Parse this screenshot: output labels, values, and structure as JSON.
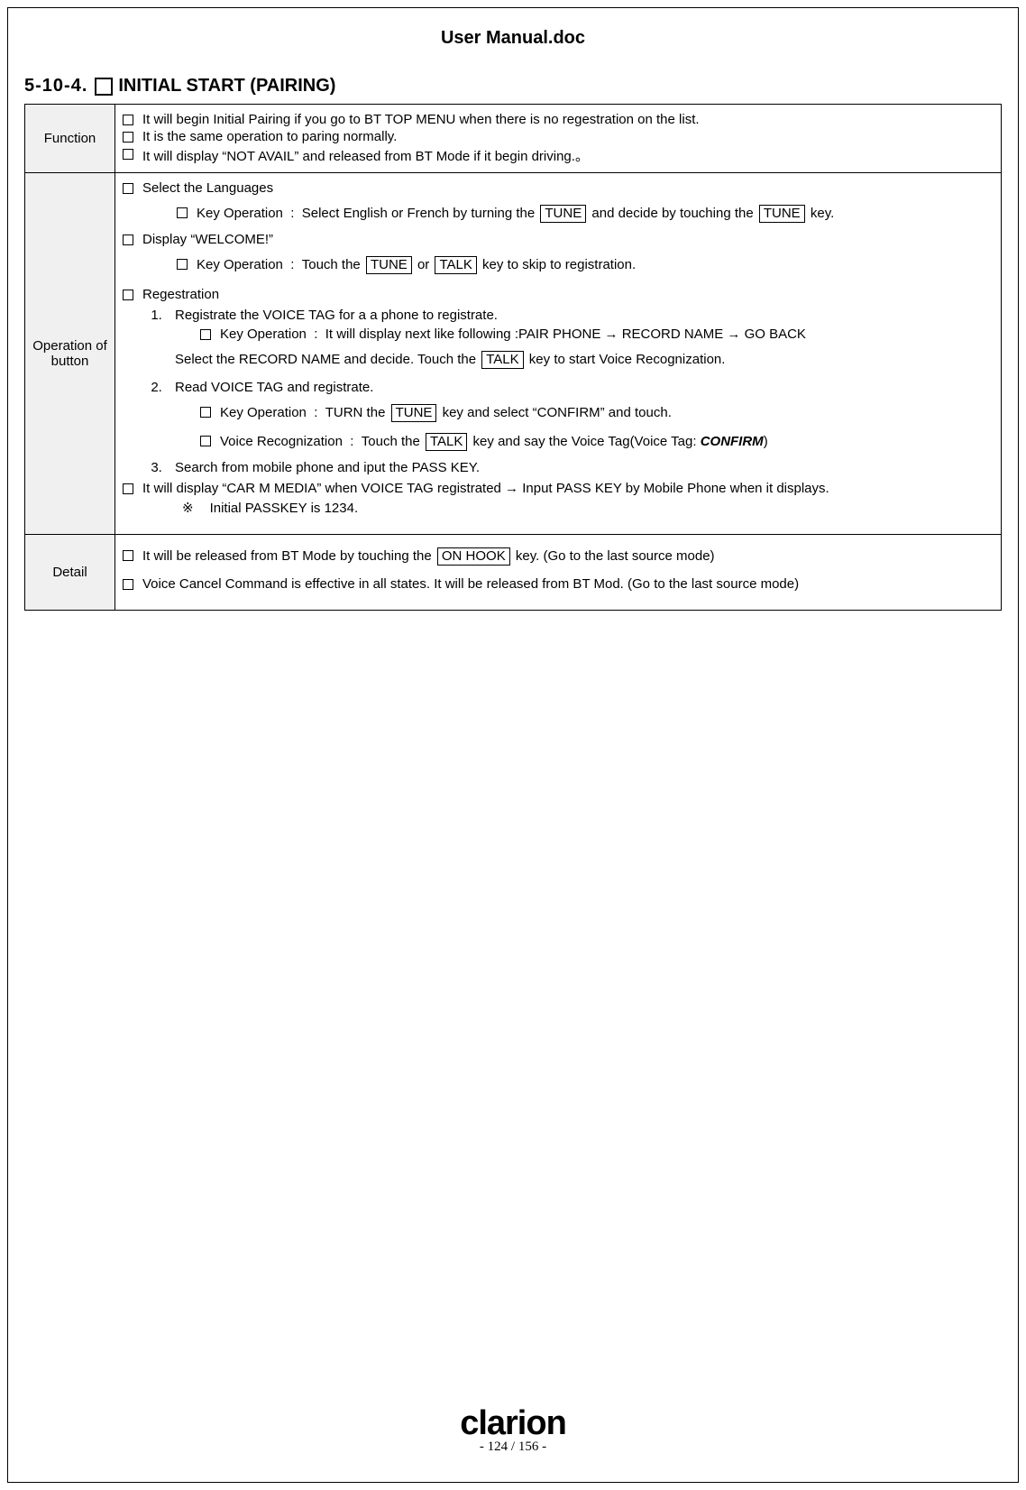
{
  "header": {
    "title": "User Manual.doc"
  },
  "section": {
    "number": "5-10-4.",
    "title": "INITIAL START (PAIRING)"
  },
  "rows": {
    "function": {
      "label": "Function",
      "b1": "It will begin Initial Pairing if you go to BT TOP MENU when there is no regestration on the list.",
      "b2": "It is the same operation to paring normally.",
      "b3_a": "It will display ",
      "b3_q": "“NOT AVAIL”",
      "b3_b": " and released from BT Mode if it begin driving.。"
    },
    "operation": {
      "label": "Operation of button",
      "sel_lang": "Select the Languages",
      "sel_lang_key_a": "Key Operation  :  Select English or French by turning the ",
      "k_tune": "TUNE",
      "sel_lang_key_b": " and decide by touching the ",
      "sel_lang_key_c": "  key.",
      "disp_welcome_a": "Display ",
      "disp_welcome_q": "“WELCOME!”",
      "welcome_key_a": "Key Operation  :  Touch the ",
      "welcome_key_or": " or ",
      "k_talk": "TALK",
      "welcome_key_b": " key to skip to registration.",
      "regestration": "Regestration",
      "reg1_title": "Registrate the VOICE TAG for a a phone to registrate.",
      "reg1_key": "Key Operation  :  It will display next like following :PAIR PHONE → RECORD NAME → GO BACK",
      "reg1_sel_a": "Select the RECORD NAME and decide. Touch the ",
      "reg1_sel_b": " key to start Voice Recognization.",
      "reg2_title": "Read VOICE TAG and registrate.",
      "reg2_key_a": "Key Operation  :  TURN the ",
      "reg2_key_b": " key and select ",
      "reg2_key_q": "“CONFIRM”",
      "reg2_key_c": " and touch.",
      "reg2_vr_a": "Voice Recognization  :  Touch the ",
      "reg2_vr_b": " key and say the Voice Tag(Voice Tag: ",
      "reg2_vr_conf": "CONFIRM",
      "reg2_vr_c": ")",
      "reg3_title": "Search from mobile phone and iput the PASS KEY.",
      "reg_last_a": "It will display ",
      "reg_last_q": "“CAR M MEDIA”",
      "reg_last_b": " when VOICE TAG registrated → Input PASS KEY by Mobile Phone when it displays.",
      "note_sym": "※",
      "note_text": "Initial PASSKEY is 1234."
    },
    "detail": {
      "label": "Detail",
      "b1_a": "It will be released from BT Mode by touching the ",
      "k_onhook": "ON HOOK",
      "b1_b": " key. (Go to the last source mode)",
      "b2": "Voice Cancel Command is effective in all states. It will be released from BT Mod. (Go to the last source mode)"
    }
  },
  "footer": {
    "brand": "clarion",
    "page": "- 124 / 156 -"
  }
}
